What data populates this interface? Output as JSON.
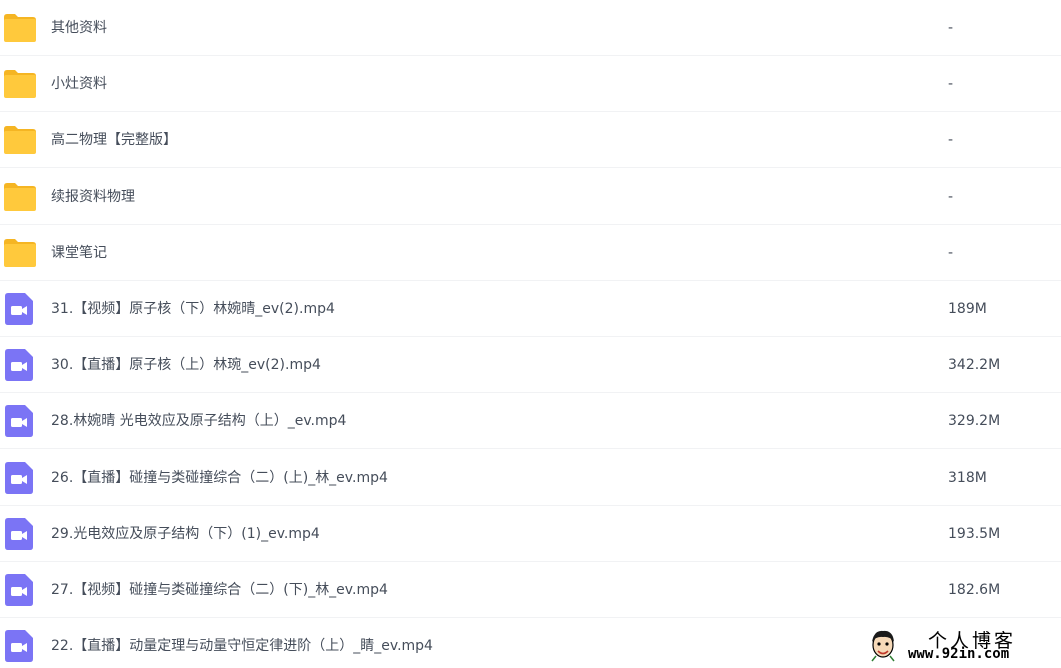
{
  "colors": {
    "folder": "#ffc93c",
    "folder_tab": "#f5b523",
    "video": "#7b74f5",
    "text": "#454d5a",
    "divider": "#f1f2f4"
  },
  "files": [
    {
      "type": "folder",
      "icon": "folder-icon",
      "name": "其他资料",
      "size": "-"
    },
    {
      "type": "folder",
      "icon": "folder-icon",
      "name": "小灶资料",
      "size": "-"
    },
    {
      "type": "folder",
      "icon": "folder-icon",
      "name": "高二物理【完整版】",
      "size": "-"
    },
    {
      "type": "folder",
      "icon": "folder-icon",
      "name": "续报资料物理",
      "size": "-"
    },
    {
      "type": "folder",
      "icon": "folder-icon",
      "name": "课堂笔记",
      "size": "-"
    },
    {
      "type": "video",
      "icon": "video-file-icon",
      "name": "31.【视频】原子核（下）林婉晴_ev(2).mp4",
      "size": "189M"
    },
    {
      "type": "video",
      "icon": "video-file-icon",
      "name": "30.【直播】原子核（上）林琬_ev(2).mp4",
      "size": "342.2M"
    },
    {
      "type": "video",
      "icon": "video-file-icon",
      "name": "28.林婉晴 光电效应及原子结构（上）_ev.mp4",
      "size": "329.2M"
    },
    {
      "type": "video",
      "icon": "video-file-icon",
      "name": "26.【直播】碰撞与类碰撞综合（二）(上)_林_ev.mp4",
      "size": "318M"
    },
    {
      "type": "video",
      "icon": "video-file-icon",
      "name": "29.光电效应及原子结构（下）(1)_ev.mp4",
      "size": "193.5M"
    },
    {
      "type": "video",
      "icon": "video-file-icon",
      "name": "27.【视频】碰撞与类碰撞综合（二）(下)_林_ev.mp4",
      "size": "182.6M"
    },
    {
      "type": "video",
      "icon": "video-file-icon",
      "name": "22.【直播】动量定理与动量守恒定律进阶（上）_睛_ev.mp4",
      "size": ""
    }
  ],
  "watermark": {
    "title": "个人博客",
    "url": "www.92in.com"
  }
}
